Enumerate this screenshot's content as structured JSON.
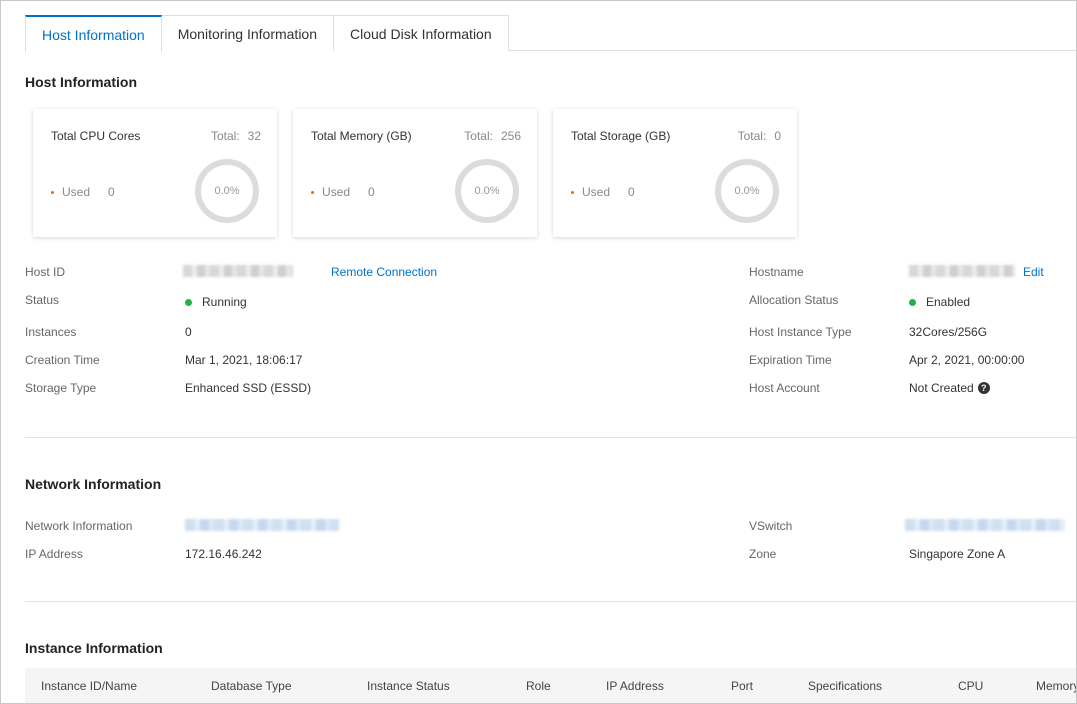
{
  "tabs": [
    {
      "label": "Host Information",
      "active": true
    },
    {
      "label": "Monitoring Information",
      "active": false
    },
    {
      "label": "Cloud Disk Information",
      "active": false
    }
  ],
  "host_section": {
    "title": "Host Information",
    "cards": [
      {
        "title": "Total CPU Cores",
        "total_label": "Total:",
        "total": "32",
        "used_label": "Used",
        "used": "0",
        "percent": "0.0%"
      },
      {
        "title": "Total Memory (GB)",
        "total_label": "Total:",
        "total": "256",
        "used_label": "Used",
        "used": "0",
        "percent": "0.0%"
      },
      {
        "title": "Total Storage (GB)",
        "total_label": "Total:",
        "total": "0",
        "used_label": "Used",
        "used": "0",
        "percent": "0.0%"
      }
    ],
    "left_fields": {
      "host_id": {
        "label": "Host ID",
        "link": "Remote Connection"
      },
      "status": {
        "label": "Status",
        "value": "Running"
      },
      "instances": {
        "label": "Instances",
        "value": "0"
      },
      "creation_time": {
        "label": "Creation Time",
        "value": "Mar 1, 2021, 18:06:17"
      },
      "storage_type": {
        "label": "Storage Type",
        "value": "Enhanced SSD (ESSD)"
      }
    },
    "right_fields": {
      "hostname": {
        "label": "Hostname",
        "link": "Edit"
      },
      "allocation_status": {
        "label": "Allocation Status",
        "value": "Enabled"
      },
      "host_instance_type": {
        "label": "Host Instance Type",
        "value": "32Cores/256G"
      },
      "expiration_time": {
        "label": "Expiration Time",
        "value": "Apr 2, 2021, 00:00:00"
      },
      "host_account": {
        "label": "Host Account",
        "value": "Not Created"
      }
    }
  },
  "network_section": {
    "title": "Network Information",
    "network_info": {
      "label": "Network Information"
    },
    "ip_address": {
      "label": "IP Address",
      "value": "172.16.46.242"
    },
    "vswitch": {
      "label": "VSwitch"
    },
    "zone": {
      "label": "Zone",
      "value": "Singapore Zone A"
    }
  },
  "instance_section": {
    "title": "Instance Information",
    "columns": [
      "Instance ID/Name",
      "Database Type",
      "Instance Status",
      "Role",
      "IP Address",
      "Port",
      "Specifications",
      "CPU",
      "Memory"
    ]
  },
  "colors": {
    "accent": "#0070cc",
    "status_green": "#22b14c",
    "used_dot": "#e86b1f"
  }
}
